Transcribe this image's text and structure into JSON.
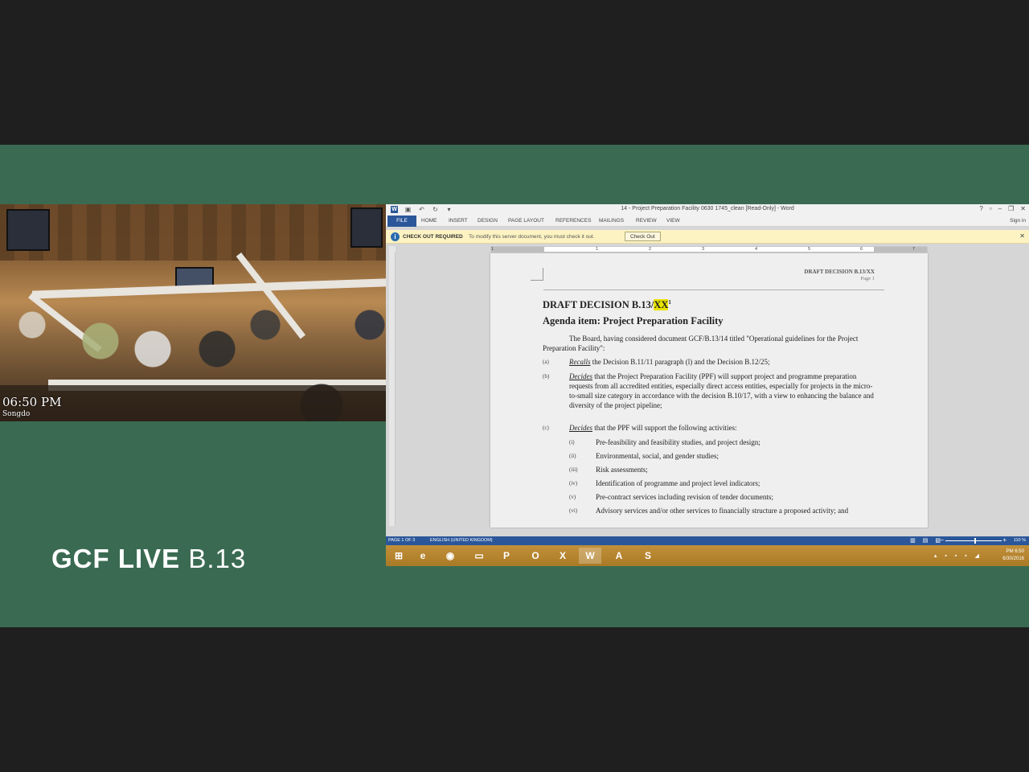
{
  "camera": {
    "time": "06:50 PM",
    "location": "Songdo"
  },
  "brand": {
    "bold": "GCF LIVE",
    "light": " B.13"
  },
  "word": {
    "window_title": "14 - Project Preparation Facility 0630 1745_clean [Read-Only] - Word",
    "window_controls": [
      "?",
      "▫",
      "–",
      "❐",
      "✕"
    ],
    "ribbon_tabs": [
      "FILE",
      "HOME",
      "INSERT",
      "DESIGN",
      "PAGE LAYOUT",
      "REFERENCES",
      "MAILINGS",
      "REVIEW",
      "VIEW"
    ],
    "sign_in": "Sign in",
    "infobar": {
      "title": "CHECK OUT REQUIRED",
      "message": "To modify this server document, you must check it out.",
      "button": "Check Out"
    },
    "ruler_numbers": [
      "1",
      "1",
      "2",
      "3",
      "4",
      "5",
      "6",
      "7"
    ],
    "document": {
      "header_title": "DRAFT DECISION B.13/XX",
      "header_page": "Page 1",
      "heading_prefix": "DRAFT DECISION B.13/",
      "heading_highlight": "XX",
      "heading_footnote": "1",
      "agenda": "Agenda item:  Project Preparation Facility",
      "intro": "The Board, having considered document GCF/B.13/14 titled \"Operational guidelines for the Project Preparation Facility\":",
      "items": [
        {
          "label": "(a)",
          "verb": "Recalls",
          "text": " the Decision B.11/11 paragraph (l) and the Decision B.12/25;"
        },
        {
          "label": "(b)",
          "verb": "Decides",
          "text": " that the Project Preparation Facility (PPF) will support project and programme preparation requests from all accredited entities, especially direct access entities, especially for projects in the micro-to-small size category in accordance with the decision B.10/17, with a view to enhancing the balance and diversity of the project pipeline;"
        },
        {
          "label": "(c)",
          "verb": "Decides",
          "text": " that the PPF will support the following activities:"
        }
      ],
      "subitems": [
        {
          "label": "(i)",
          "text": "Pre-feasibility and feasibility studies, and project design;"
        },
        {
          "label": "(ii)",
          "text": "Environmental, social, and gender studies;"
        },
        {
          "label": "(iii)",
          "text": "Risk assessments;"
        },
        {
          "label": "(iv)",
          "text": "Identification of programme and project level indicators;"
        },
        {
          "label": "(v)",
          "text": "Pre-contract services including revision of tender documents;"
        },
        {
          "label": "(vi)",
          "text": "Advisory services and/or other services to financially structure a proposed activity; and"
        }
      ]
    },
    "status": {
      "page": "PAGE 1 OF 3",
      "language": "ENGLISH (UNITED KINGDOM)",
      "zoom": "110 %"
    },
    "taskbar": {
      "apps": [
        "start",
        "internet-explorer",
        "chrome",
        "file-explorer",
        "powerpoint",
        "outlook",
        "excel",
        "word",
        "acrobat",
        "skype"
      ],
      "clock_time": "PM 6:50",
      "clock_date": "6/30/2016"
    }
  },
  "colors": {
    "background": "#1f1f1f",
    "band": "#3a6b52",
    "word_blue": "#2b579a",
    "highlight": "#e8e400",
    "taskbar": "#b8842a"
  }
}
